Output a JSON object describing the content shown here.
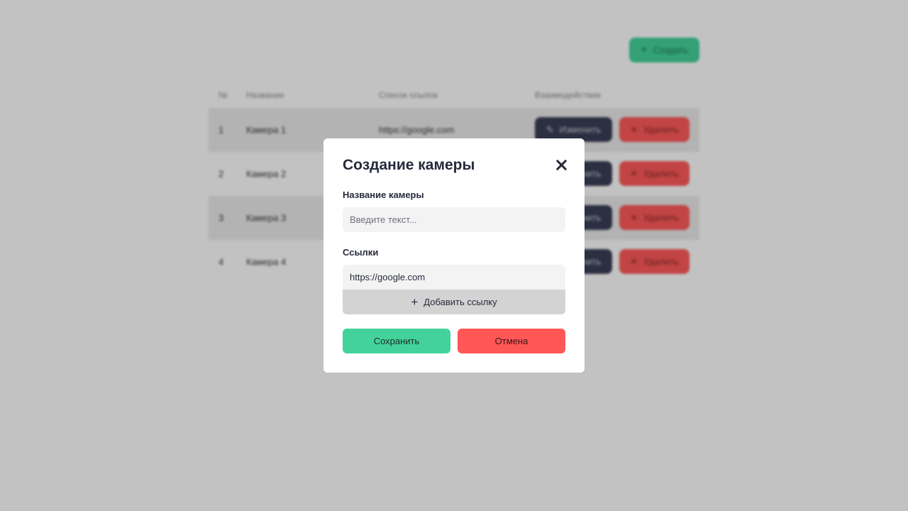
{
  "background": {
    "create_button": {
      "icon": "plus-icon",
      "label": "Создать"
    },
    "table": {
      "headers": [
        "№",
        "Название",
        "Список ссылок",
        "Взаимодействие"
      ],
      "rows": [
        {
          "num": "1",
          "name": "Камера 1",
          "links": "https://google.com"
        },
        {
          "num": "2",
          "name": "Камера 2",
          "links": ""
        },
        {
          "num": "3",
          "name": "Камера 3",
          "links": ""
        },
        {
          "num": "4",
          "name": "Камера 4",
          "links": ""
        }
      ],
      "edit_label": "Изменить",
      "edit_icon": "pencil-icon",
      "delete_label": "Удалить",
      "delete_icon": "close-icon"
    }
  },
  "modal": {
    "title": "Создание камеры",
    "close_icon": "close-icon",
    "name_field": {
      "label": "Название камеры",
      "placeholder": "Введите текст...",
      "value": ""
    },
    "links_field": {
      "label": "Ссылки",
      "items": [
        "https://google.com"
      ],
      "add_label": "Добавить ссылку",
      "add_icon": "plus-icon"
    },
    "save_label": "Сохранить",
    "cancel_label": "Отмена"
  },
  "colors": {
    "accent_green": "#43d39a",
    "accent_red": "#ff5656",
    "dark": "#3b3f57",
    "overlay": "rgba(0,0,0,0.24)"
  }
}
